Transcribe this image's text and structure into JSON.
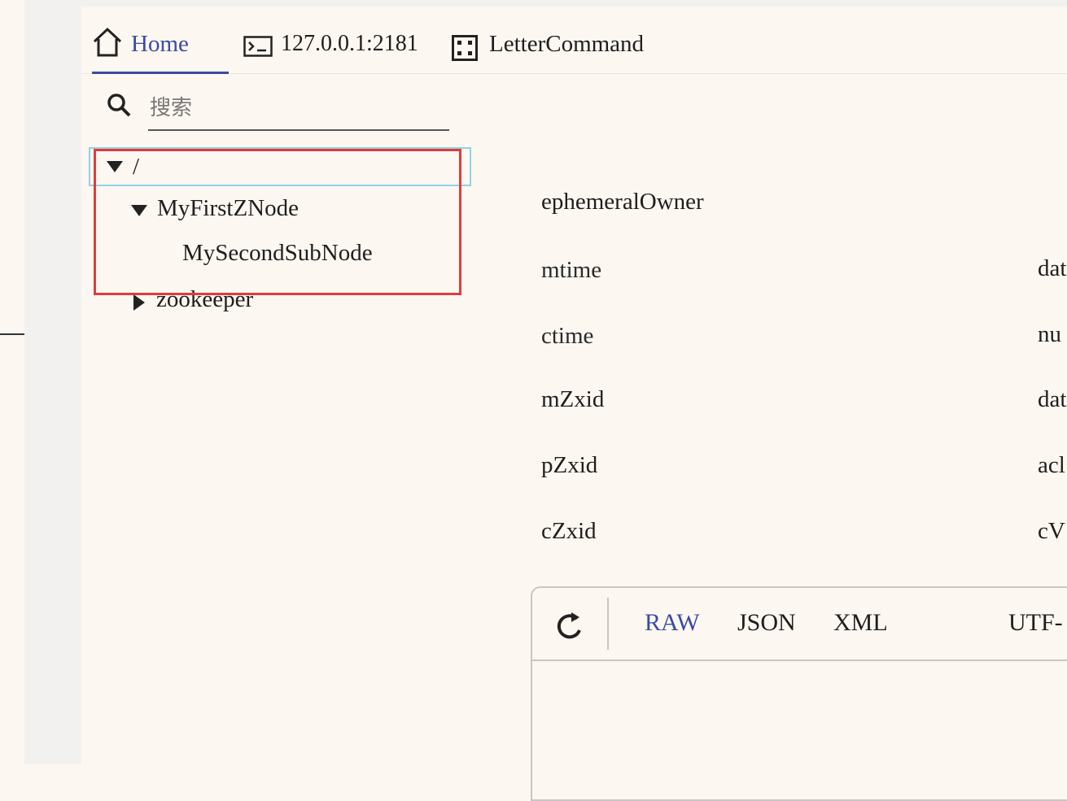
{
  "tabs": {
    "home": "Home",
    "connection": "127.0.0.1:2181",
    "letter_command": "LetterCommand"
  },
  "search": {
    "placeholder": "搜索"
  },
  "tree": {
    "root": "/",
    "node1": "MyFirstZNode",
    "node1_child": "MySecondSubNode",
    "node2": "zookeeper"
  },
  "stats": {
    "left": [
      "ephemeralOwner",
      "mtime",
      "ctime",
      "mZxid",
      "pZxid",
      "cZxid"
    ],
    "right_partial": [
      "dat",
      "nu",
      "dat",
      "acl",
      "cV"
    ]
  },
  "editor": {
    "formats": [
      "RAW",
      "JSON",
      "XML"
    ],
    "encoding_partial": "UTF-"
  },
  "colors": {
    "accent": "#3b4aa8",
    "highlight": "#e23b3b",
    "selected_border": "#8fd3e6"
  }
}
